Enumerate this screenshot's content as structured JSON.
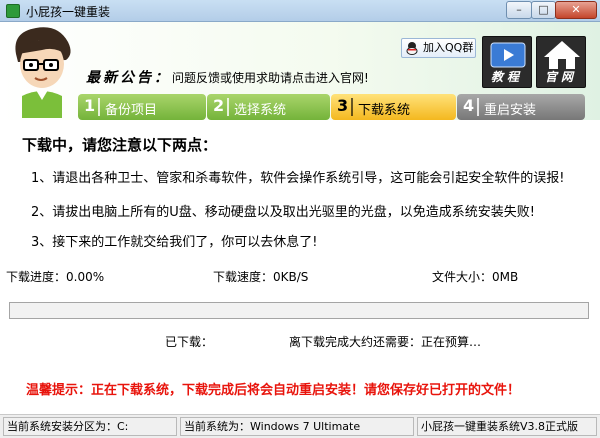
{
  "window": {
    "title": "小屁孩一键重装",
    "min_glyph": "–",
    "max_glyph": "□",
    "close_glyph": "✕"
  },
  "header": {
    "notice_label": "最新公告：",
    "notice_text": "问题反馈或使用求助请点击进入官网!",
    "qq_button": "加入QQ群",
    "tutorial_label": "教程",
    "website_label": "官网"
  },
  "steps": [
    {
      "num": "1",
      "label": "备份项目"
    },
    {
      "num": "2",
      "label": "选择系统"
    },
    {
      "num": "3",
      "label": "下载系统"
    },
    {
      "num": "4",
      "label": "重启安装"
    }
  ],
  "content": {
    "title": "下载中，请您注意以下两点：",
    "lines": [
      "1、请退出各种卫士、管家和杀毒软件，软件会操作系统引导，这可能会引起安全软件的误报!",
      "2、请拔出电脑上所有的U盘、移动硬盘以及取出光驱里的光盘，以免造成系统安装失败!",
      "3、接下来的工作就交给我们了，你可以去休息了!"
    ]
  },
  "download": {
    "progress_text": "下载进度：0.00%",
    "speed_text": "下载速度：0KB/S",
    "size_text": "文件大小：0MB",
    "progress_fraction": 0,
    "downloaded_text": "已下载：",
    "remaining_text": "离下载完成大约还需要：正在预算…"
  },
  "warning": "温馨提示：正在下载系统，下载完成后将会自动重启安装！请您保存好已打开的文件！",
  "statusbar": {
    "partition": "当前系统安装分区为：C:",
    "system": "当前系统为：Windows 7 Ultimate",
    "version": "小屁孩一键重装系统V3.8正式版"
  },
  "colors": {
    "step_done": "#74b33a",
    "step_active": "#f4b81f",
    "step_pending": "#777777",
    "warning": "#e8140c",
    "progress_fill": "#4fb846"
  }
}
